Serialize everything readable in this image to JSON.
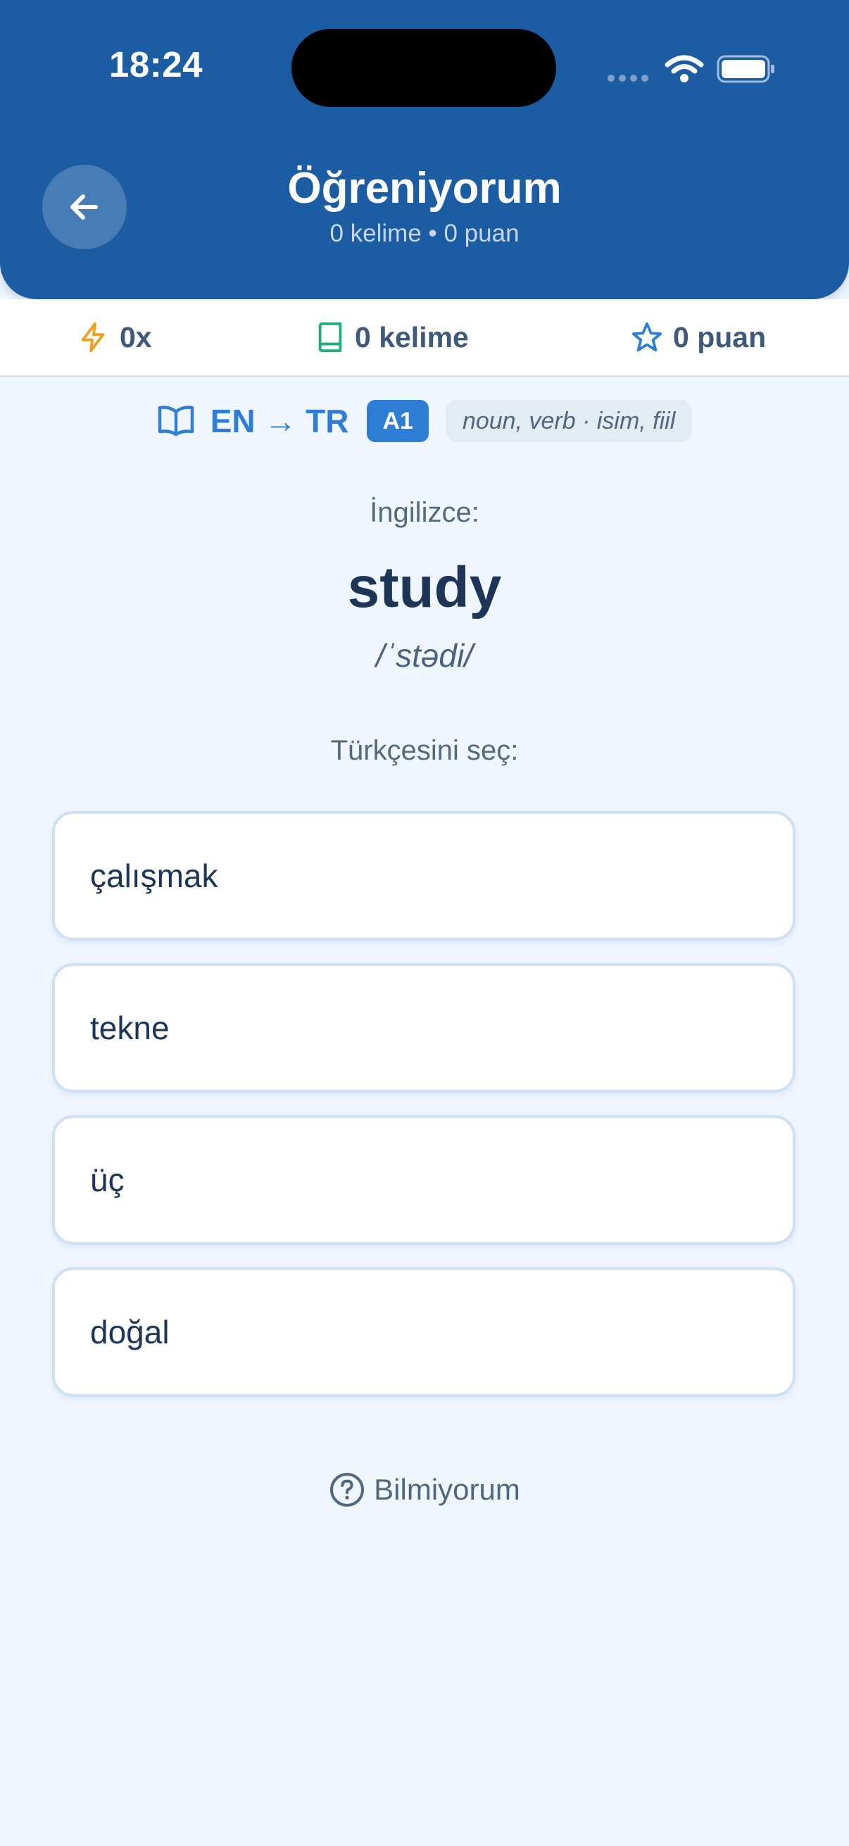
{
  "status_bar": {
    "time": "18:24"
  },
  "header": {
    "title": "Öğreniyorum",
    "subtitle": "0 kelime • 0 puan",
    "back_icon": "arrow-left-icon"
  },
  "stats": {
    "streak": "0x",
    "words": "0 kelime",
    "points": "0 puan"
  },
  "colors": {
    "header_bg": "#1b5ca3",
    "accent": "#2f7ed6",
    "page_bg": "#eff6fd",
    "streak_icon": "#f0a020",
    "words_icon": "#1fae7a",
    "points_icon": "#2f7ed6"
  },
  "quiz": {
    "lang_pair": "EN → TR",
    "level": "A1",
    "pos_tag": "noun, verb · isim, fiil",
    "source_label": "İngilizce:",
    "word": "study",
    "pronunciation": "/ˈstədi/",
    "prompt": "Türkçesini seç:",
    "options": [
      {
        "label": "çalışmak"
      },
      {
        "label": "tekne"
      },
      {
        "label": "üç"
      },
      {
        "label": "doğal"
      }
    ],
    "dont_know": "Bilmiyorum"
  }
}
